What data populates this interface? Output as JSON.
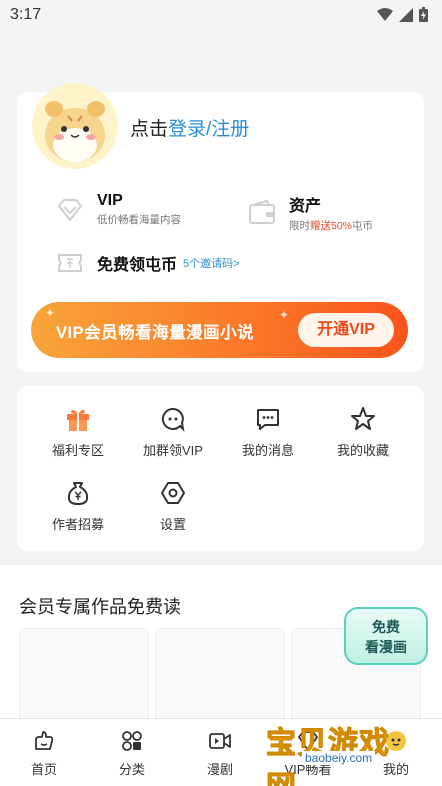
{
  "status_bar": {
    "time": "3:17"
  },
  "profile": {
    "login_prefix": "点击",
    "login_link": "登录/注册"
  },
  "features": [
    {
      "title": "VIP",
      "subtitle": "低价畅看海量内容"
    },
    {
      "title": "资产",
      "subtitle_pre": "限时",
      "subtitle_hl": "赠送50%",
      "subtitle_post": "屯币"
    },
    {
      "title": "免费领屯币",
      "extra": "5个邀请码>"
    }
  ],
  "vip_banner": {
    "text": "VIP会员畅看海量漫画小说",
    "button": "开通VIP"
  },
  "menu": [
    {
      "label": "福利专区",
      "icon": "gift-icon"
    },
    {
      "label": "加群领VIP",
      "icon": "group-chat-icon"
    },
    {
      "label": "我的消息",
      "icon": "message-icon"
    },
    {
      "label": "我的收藏",
      "icon": "star-icon"
    },
    {
      "label": "作者招募",
      "icon": "money-bag-icon"
    },
    {
      "label": "设置",
      "icon": "settings-icon"
    }
  ],
  "section": {
    "title": "会员专属作品免费读"
  },
  "free_badge": {
    "line1": "免费",
    "line2": "看漫画"
  },
  "tabs": [
    {
      "label": "首页",
      "icon": "home-icon"
    },
    {
      "label": "分类",
      "icon": "category-icon"
    },
    {
      "label": "漫剧",
      "icon": "video-icon"
    },
    {
      "label": "VIP畅看",
      "icon": "vip-icon"
    },
    {
      "label": "我的",
      "icon": "profile-icon"
    }
  ],
  "watermark": {
    "title": "宝贝游戏网",
    "url": "baobeiy.com"
  },
  "colors": {
    "accent": "#2a8fd6",
    "vip_orange": "#fb7a2a",
    "highlight": "#e8482c"
  }
}
